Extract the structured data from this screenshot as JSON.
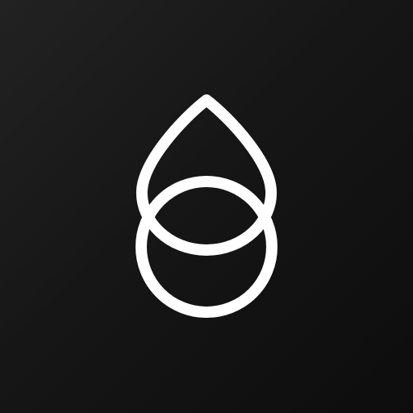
{
  "icon": {
    "name": "drop-ring-logo-icon",
    "background": {
      "start": "#222222",
      "end": "#0d0d0d"
    },
    "stroke_color": "#ffffff"
  }
}
